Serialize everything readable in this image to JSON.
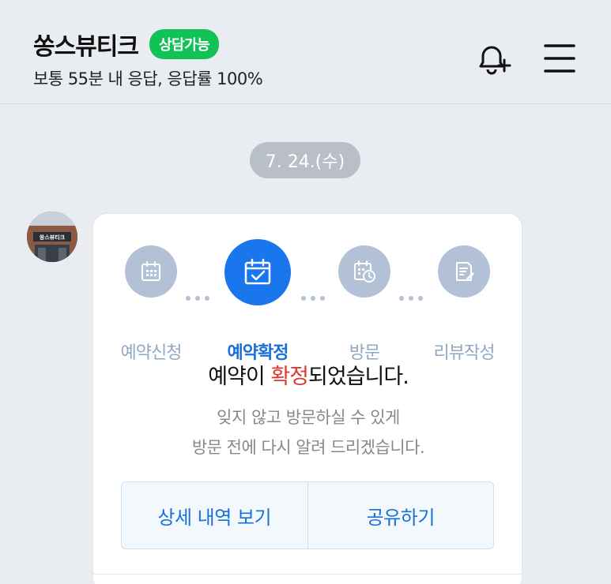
{
  "header": {
    "title": "쏭스뷰티크",
    "status_badge": "상담가능",
    "subtitle": "보통 55분 내 응답, 응답률 100%",
    "bell_icon": "bell-plus-icon",
    "menu_icon": "hamburger-menu-icon"
  },
  "chat": {
    "date": "7. 24.(수)",
    "avatar_text": "쏭스뷰티크"
  },
  "card": {
    "steps": [
      {
        "label": "예약신청",
        "icon": "calendar-grid-icon",
        "active": false
      },
      {
        "label": "예약확정",
        "icon": "calendar-check-icon",
        "active": true
      },
      {
        "label": "방문",
        "icon": "calendar-clock-icon",
        "active": false
      },
      {
        "label": "리뷰작성",
        "icon": "review-edit-icon",
        "active": false
      }
    ],
    "headline_prefix": "예약이 ",
    "headline_highlight": "확정",
    "headline_suffix": "되었습니다.",
    "desc_line1": "잊지 않고 방문하실 수 있게",
    "desc_line2": "방문 전에 다시 알려 드리겠습니다.",
    "detail_button": "상세 내역 보기",
    "share_button": "공유하기"
  },
  "colors": {
    "accent": "#1976ec",
    "badge": "#12c257",
    "highlight": "#e0392e",
    "step_inactive": "#b2c1d5"
  }
}
